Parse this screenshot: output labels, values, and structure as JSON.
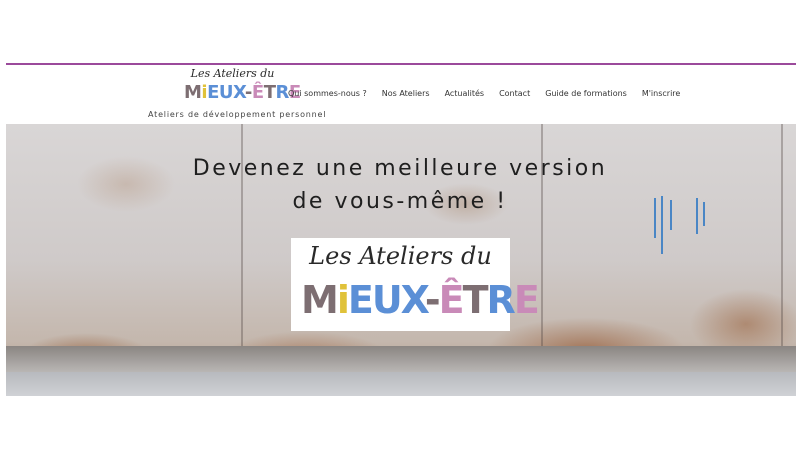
{
  "colors": {
    "accent_rule": "#9b4a9b",
    "logo_gray": "#7d6e72",
    "logo_yellow": "#e0c23a",
    "logo_blue": "#5b8fd6",
    "logo_pink": "#c98ab8"
  },
  "header": {
    "logo": {
      "script_text": "Les Ateliers du",
      "letters": [
        "M",
        "i",
        "EUX",
        "-",
        "Ê",
        "T",
        "R",
        "E"
      ]
    },
    "tagline": "Ateliers de développement personnel"
  },
  "nav": {
    "items": [
      "Qui sommes-nous ?",
      "Nos Ateliers",
      "Actualités",
      "Contact",
      "Guide de formations",
      "M'inscrire"
    ]
  },
  "hero": {
    "headline_line1": "Devenez une meilleure version",
    "headline_line2": "de vous-même !",
    "logo": {
      "script_text": "Les Ateliers du",
      "letters": [
        "M",
        "i",
        "EUX",
        "-",
        "Ê",
        "T",
        "R",
        "E"
      ]
    }
  }
}
